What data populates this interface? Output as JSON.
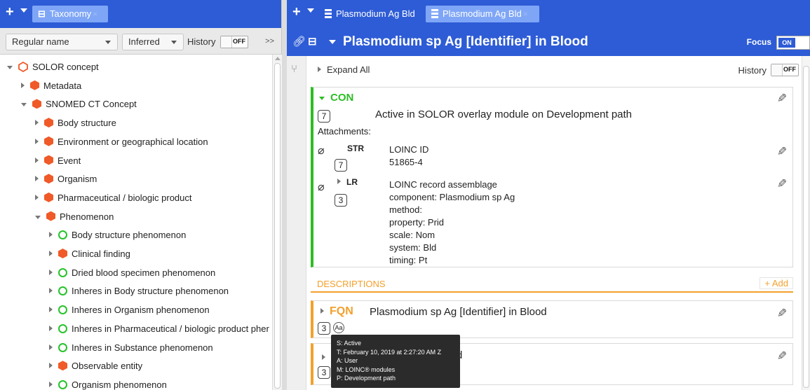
{
  "left_tabs": {
    "plus": "+",
    "taxonomy_tab": "Taxonomy",
    "close": "×"
  },
  "left_toolbar": {
    "name_mode": "Regular name",
    "premise": "Inferred",
    "history_label": "History",
    "history_state": "OFF",
    "chevron": ">>"
  },
  "tree": [
    {
      "label": "SOLOR concept",
      "icon": "hex-outline-icon",
      "expanded": true
    },
    {
      "label": "Metadata",
      "icon": "hex-icon",
      "expanded": false
    },
    {
      "label": "SNOMED CT Concept",
      "icon": "hex-icon",
      "expanded": true
    },
    {
      "label": "Body structure",
      "icon": "hex-icon",
      "expanded": false
    },
    {
      "label": "Environment or geographical location",
      "icon": "hex-icon",
      "expanded": false
    },
    {
      "label": "Event",
      "icon": "hex-icon",
      "expanded": false
    },
    {
      "label": "Organism",
      "icon": "hex-icon",
      "expanded": false
    },
    {
      "label": "Pharmaceutical / biologic product",
      "icon": "hex-icon",
      "expanded": false
    },
    {
      "label": "Phenomenon",
      "icon": "hex-icon",
      "expanded": true
    },
    {
      "label": "Body structure phenomenon",
      "icon": "circle-icon",
      "expanded": false
    },
    {
      "label": "Clinical finding",
      "icon": "hex-icon",
      "expanded": false
    },
    {
      "label": "Dried blood specimen phenomenon",
      "icon": "circle-icon",
      "expanded": false
    },
    {
      "label": "Inheres in Body structure phenomenon",
      "icon": "circle-icon",
      "expanded": false
    },
    {
      "label": "Inheres in Organism phenomenon",
      "icon": "circle-icon",
      "expanded": false
    },
    {
      "label": "Inheres in Pharmaceutical / biologic product pher",
      "icon": "circle-icon",
      "expanded": false
    },
    {
      "label": "Inheres in Substance phenomenon",
      "icon": "circle-icon",
      "expanded": false
    },
    {
      "label": "Observable entity",
      "icon": "hex-icon",
      "expanded": false
    },
    {
      "label": "Organism phenomenon",
      "icon": "circle-icon",
      "expanded": false
    }
  ],
  "right_tabs": {
    "tab1": "Plasmodium Ag Bld",
    "tab2": "Plasmodium Ag Bld",
    "close": "×"
  },
  "concept_header": {
    "title": "Plasmodium sp Ag [Identifier] in Blood",
    "focus_label": "Focus",
    "focus_state": "ON"
  },
  "detail_bar": {
    "expand_all": "Expand All",
    "history_label": "History",
    "history_state": "OFF"
  },
  "con_card": {
    "label": "CON",
    "badge": "7",
    "status_text": "Active in SOLOR overlay module on Development path",
    "attachments_label": "Attachments:",
    "attachments": [
      {
        "type": "STR",
        "badge": "7",
        "lines": [
          "LOINC ID",
          "51865-4"
        ]
      },
      {
        "type": "LR",
        "badge": "3",
        "lines": [
          "LOINC record assemblage",
          "component: Plasmodium sp Ag",
          "method:",
          "property: Prid",
          "scale: Nom",
          "system: Bld",
          "timing: Pt"
        ]
      }
    ]
  },
  "descriptions": {
    "section_label": "DESCRIPTIONS",
    "add_label": "+ Add",
    "fqn_label": "FQN",
    "fqn_text": "Plasmodium sp Ag [Identifier] in Blood",
    "fqn_badge": "3",
    "case_icon": "Aa",
    "card2_badge": "3",
    "card2_tail": "d"
  },
  "tooltip": {
    "lines": [
      "S: Active",
      "T: February 10, 2019 at 2:27:20 AM Z",
      "A: User",
      "M: LOINC® modules",
      "P: Development path"
    ]
  },
  "colors": {
    "header_blue": "#2e5cd6",
    "concept_green": "#2cbd24",
    "description_orange": "#f2a02d",
    "hex_orange": "#f05a28",
    "circle_green": "#27c22b"
  }
}
